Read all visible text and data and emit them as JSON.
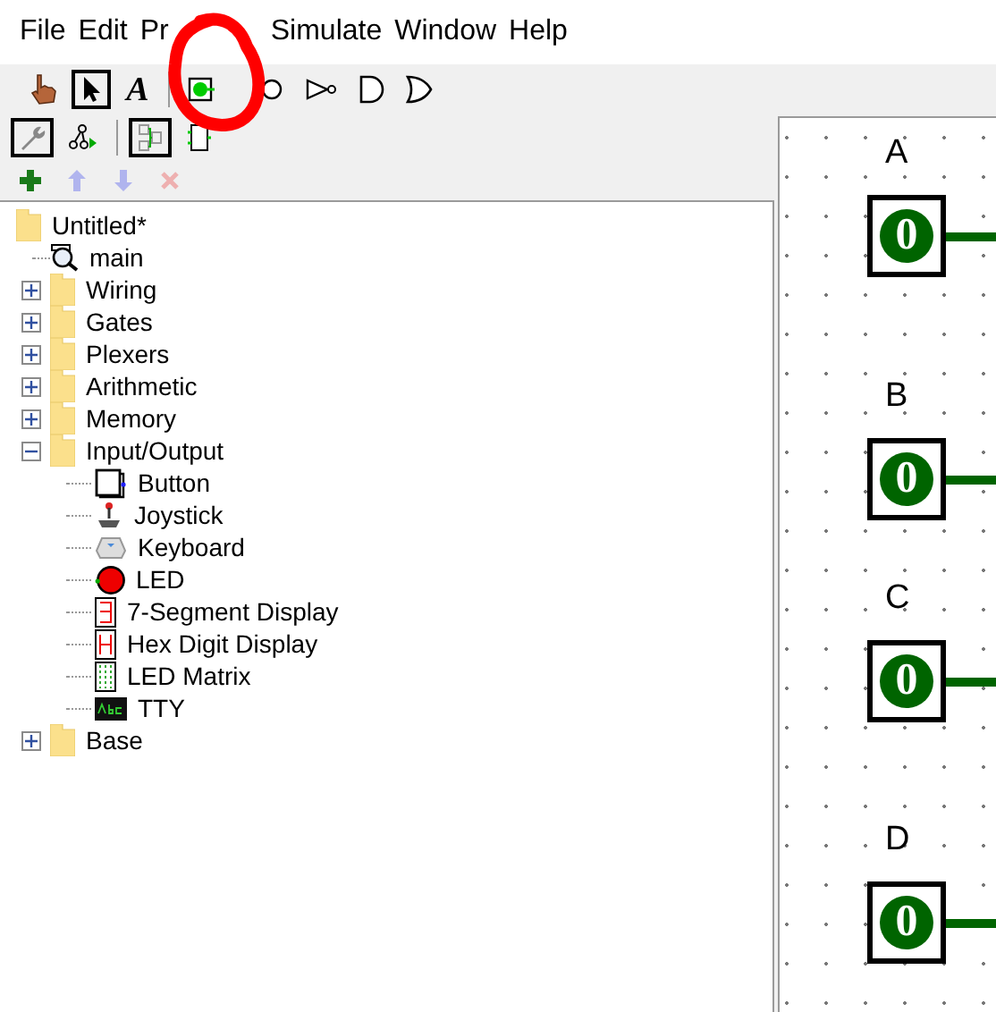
{
  "menu": [
    "File",
    "Edit",
    "Pr",
    "Simulate",
    "Window",
    "Help"
  ],
  "toolbar": [
    {
      "kind": "hand",
      "selected": false
    },
    {
      "kind": "select",
      "selected": true
    },
    {
      "kind": "text",
      "label": "A",
      "selected": false
    },
    {
      "kind": "separator"
    },
    {
      "kind": "pin-in",
      "selected": false
    },
    {
      "kind": "pin-out",
      "selected": false
    },
    {
      "kind": "not-gate",
      "selected": false
    },
    {
      "kind": "and-gate",
      "selected": false
    },
    {
      "kind": "or-gate",
      "selected": false
    }
  ],
  "explorer_toolbar": [
    {
      "kind": "wrench",
      "selected": true
    },
    {
      "kind": "sim-tree",
      "selected": false
    },
    {
      "kind": "separator"
    },
    {
      "kind": "layout",
      "selected": true
    },
    {
      "kind": "appearance",
      "selected": false
    }
  ],
  "edit_toolbar": [
    {
      "kind": "add",
      "disabled": false
    },
    {
      "kind": "up",
      "disabled": true
    },
    {
      "kind": "down",
      "disabled": true
    },
    {
      "kind": "delete",
      "disabled": true
    }
  ],
  "tree": [
    {
      "label": "Untitled*",
      "kind": "folder",
      "children": [
        {
          "label": "main",
          "kind": "circuit"
        },
        {
          "label": "Wiring",
          "kind": "folder",
          "expanded": false
        },
        {
          "label": "Gates",
          "kind": "folder",
          "expanded": false
        },
        {
          "label": "Plexers",
          "kind": "folder",
          "expanded": false
        },
        {
          "label": "Arithmetic",
          "kind": "folder",
          "expanded": false
        },
        {
          "label": "Memory",
          "kind": "folder",
          "expanded": false
        },
        {
          "label": "Input/Output",
          "kind": "folder",
          "expanded": true,
          "children": [
            {
              "label": "Button",
              "kind": "button"
            },
            {
              "label": "Joystick",
              "kind": "joystick"
            },
            {
              "label": "Keyboard",
              "kind": "keyboard"
            },
            {
              "label": "LED",
              "kind": "led"
            },
            {
              "label": "7-Segment Display",
              "kind": "seven-seg"
            },
            {
              "label": "Hex Digit Display",
              "kind": "hex"
            },
            {
              "label": "LED Matrix",
              "kind": "matrix"
            },
            {
              "label": "TTY",
              "kind": "tty"
            }
          ]
        },
        {
          "label": "Base",
          "kind": "folder",
          "expanded": false
        }
      ]
    }
  ],
  "canvas": {
    "pins": [
      {
        "label": "A",
        "value": "0"
      },
      {
        "label": "B",
        "value": "0"
      },
      {
        "label": "C",
        "value": "0"
      },
      {
        "label": "D",
        "value": "0"
      }
    ]
  },
  "annotation": {
    "kind": "circle"
  }
}
